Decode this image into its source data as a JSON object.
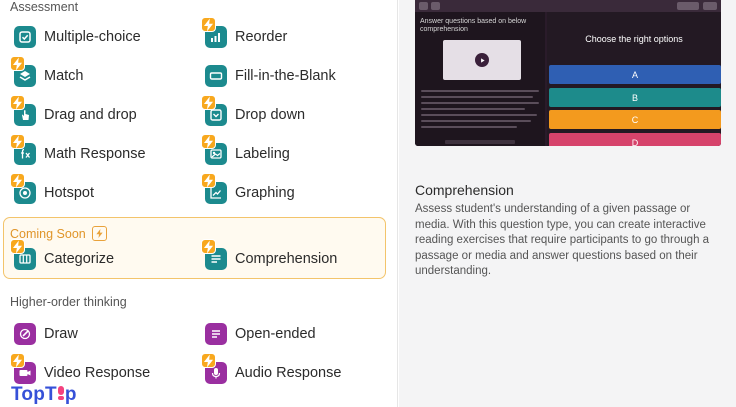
{
  "sections": {
    "assessment": "Assessment",
    "coming_soon": "Coming Soon",
    "higher_order": "Higher-order thinking"
  },
  "items": {
    "multiple_choice": "Multiple-choice",
    "reorder": "Reorder",
    "match": "Match",
    "fill_blank": "Fill-in-the-Blank",
    "drag_drop": "Drag and drop",
    "drop_down": "Drop down",
    "math_response": "Math Response",
    "labeling": "Labeling",
    "hotspot": "Hotspot",
    "graphing": "Graphing",
    "categorize": "Categorize",
    "comprehension": "Comprehension",
    "draw": "Draw",
    "open_ended": "Open-ended",
    "video_response": "Video Response",
    "audio_response": "Audio Response"
  },
  "preview": {
    "instruction": "Answer questions based on below comprehension",
    "question": "Choose the right options",
    "options": [
      "A",
      "B",
      "C",
      "D"
    ]
  },
  "description": {
    "title": "Comprehension",
    "body": "Assess student's understanding of a given passage or media. With this question type, you can create interactive reading exercises that require participants to go through a passage or media and answer questions based on their understanding."
  },
  "brand": {
    "part1": "Top",
    "part2": "T",
    "part3": "p"
  },
  "colors": {
    "teal": "#1c8a8e",
    "purple": "#9a2fa0",
    "bolt": "#f8a81e",
    "option_blue": "#2f5fb3",
    "option_teal": "#1d8b8b",
    "option_orange": "#f39a1e",
    "option_pink": "#d6436b"
  }
}
